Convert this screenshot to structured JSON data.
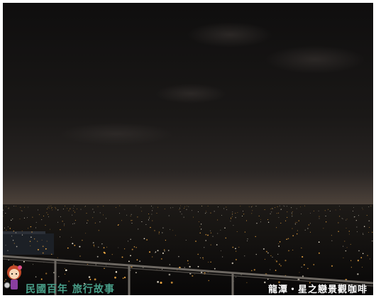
{
  "photo": {
    "subject": "night-city-skyline-photo",
    "watermark_left": "民國百年 旅行故事",
    "watermark_right": "龍潭・星之戀景觀咖啡"
  },
  "colors": {
    "sky": "#161414",
    "horizon_glow": "#3a3430",
    "city_dark": "#0c0b0a",
    "lights_warm": "#ffb347",
    "lights_white": "#fff5e0",
    "watermark_left": "#49a08a",
    "watermark_right": "#ffffff"
  },
  "icons": {
    "mascot": "girl-mascot-icon"
  }
}
